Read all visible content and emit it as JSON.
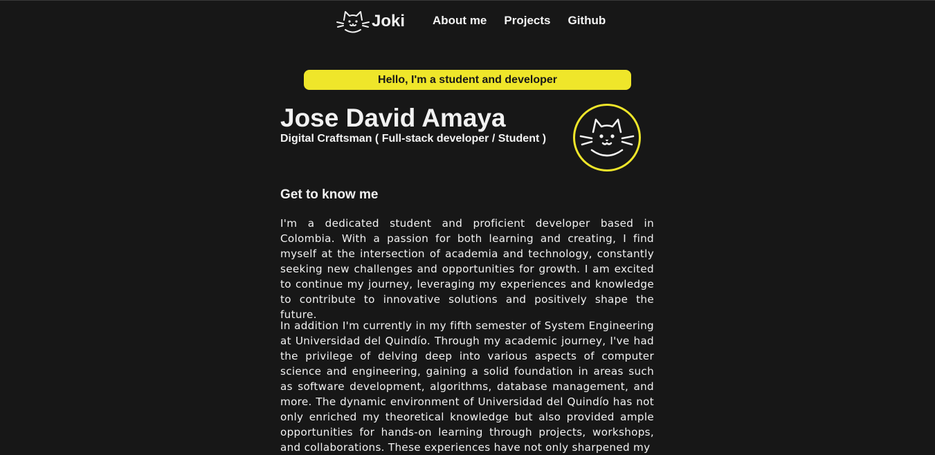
{
  "nav": {
    "brand": "Joki",
    "links": [
      {
        "label": "About me"
      },
      {
        "label": "Projects"
      },
      {
        "label": "Github"
      }
    ]
  },
  "banner": {
    "text": "Hello, I'm a student and developer"
  },
  "hero": {
    "name": "Jose David Amaya",
    "subtitle": "Digital Craftsman ( Full-stack developer / Student )"
  },
  "about": {
    "title": "Get to know me",
    "paragraphs": [
      "I'm a dedicated student and proficient developer based in Colombia. With a passion for both learning and creating, I find myself at the intersection of academia and technology, constantly seeking new challenges and opportunities for growth. I am excited to continue my journey, leveraging my experiences and knowledge to contribute to innovative solutions and positively shape the future.",
      "In addition I'm currently in my fifth semester of System Engineering at Universidad del Quindío. Through my academic journey, I've had the privilege of delving deep into various aspects of computer science and engineering, gaining a solid foundation in areas such as software development, algorithms, database management, and more. The dynamic environment of Universidad del Quindío has not only enriched my theoretical knowledge but also provided ample opportunities for hands-on learning through projects, workshops, and collaborations. These experiences have not only sharpened my"
    ]
  },
  "colors": {
    "background": "#171717",
    "accent": "#efe62a",
    "text": "#f2f2f2"
  },
  "icons": {
    "brand": "cat-face-icon",
    "avatar": "cat-face-icon"
  }
}
